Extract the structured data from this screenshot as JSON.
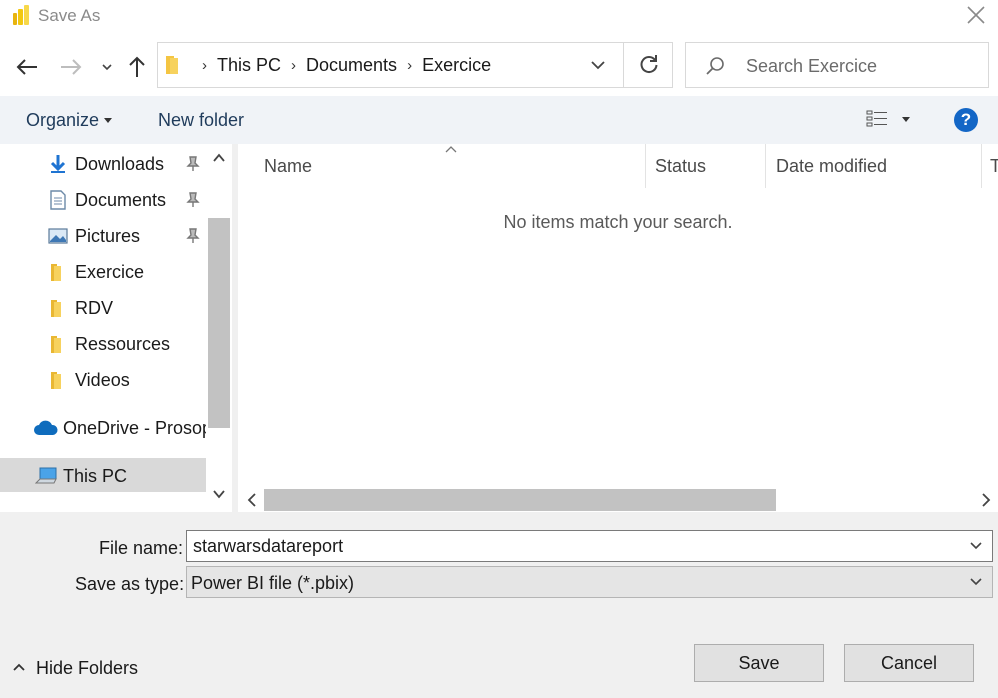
{
  "window": {
    "title": "Save As"
  },
  "nav": {
    "breadcrumbs": [
      "This PC",
      "Documents",
      "Exercice"
    ],
    "search_placeholder": "Search Exercice"
  },
  "toolbar": {
    "organize": "Organize",
    "new_folder": "New folder",
    "help": "?"
  },
  "sidebar": {
    "items": [
      {
        "label": "Downloads",
        "icon": "download-arrow-icon",
        "pinned": true
      },
      {
        "label": "Documents",
        "icon": "document-icon",
        "pinned": true
      },
      {
        "label": "Pictures",
        "icon": "pictures-icon",
        "pinned": true
      },
      {
        "label": "Exercice",
        "icon": "folder-icon",
        "pinned": false
      },
      {
        "label": "RDV",
        "icon": "folder-icon",
        "pinned": false
      },
      {
        "label": "Ressources",
        "icon": "folder-icon",
        "pinned": false
      },
      {
        "label": "Videos",
        "icon": "folder-icon",
        "pinned": false
      },
      {
        "label": "OneDrive - Prosop",
        "icon": "onedrive-cloud-icon",
        "pinned": false
      },
      {
        "label": "This PC",
        "icon": "computer-icon",
        "pinned": false,
        "selected": true
      }
    ]
  },
  "file_list": {
    "columns": [
      "Name",
      "Status",
      "Date modified",
      "T"
    ],
    "empty_message": "No items match your search."
  },
  "form": {
    "file_name_label": "File name:",
    "file_name_value": "starwarsdatareport",
    "save_as_type_label": "Save as type:",
    "save_as_type_value": "Power BI file (*.pbix)"
  },
  "footer": {
    "hide_folders": "Hide Folders",
    "save": "Save",
    "cancel": "Cancel"
  },
  "colors": {
    "accent": "#1366c6",
    "toolbar_bg": "#f0f3f7",
    "footer_bg": "#f0f0f0",
    "folder": "#f4c542",
    "powerbi": "#f2c811"
  }
}
